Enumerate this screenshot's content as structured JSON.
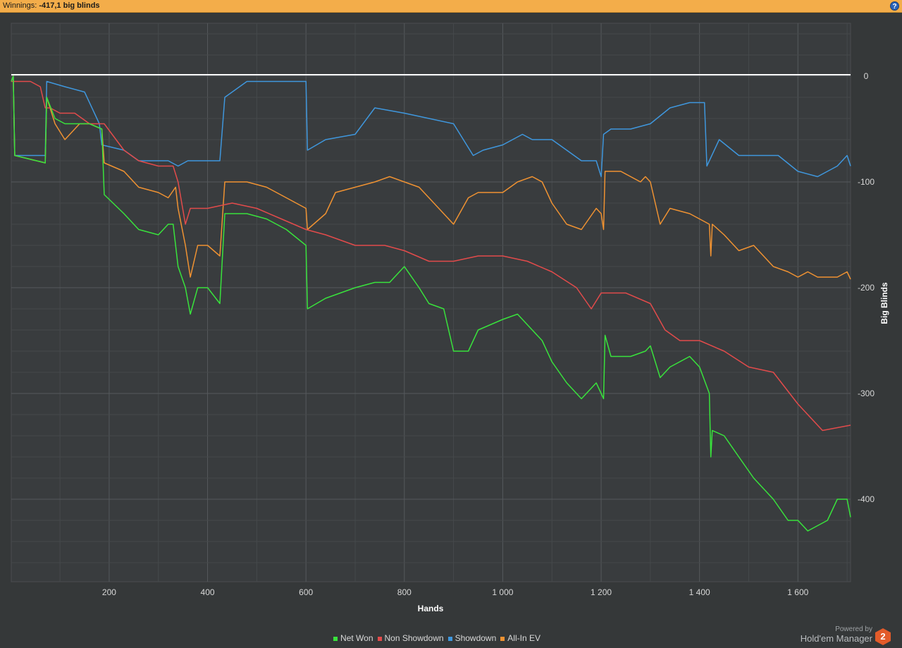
{
  "header": {
    "winnings_label": "Winnings:",
    "winnings_value": "-417,1 big blinds",
    "help_glyph": "?"
  },
  "branding": {
    "powered_by": "Powered by",
    "product": "Hold'em Manager",
    "logo_text": "2"
  },
  "chart_data": {
    "type": "line",
    "title": "",
    "xlabel": "Hands",
    "ylabel": "Big Blinds",
    "xlim": [
      1,
      1707
    ],
    "ylim": [
      -478,
      50
    ],
    "x_ticks": [
      200,
      400,
      600,
      800,
      1000,
      1200,
      1400,
      1600
    ],
    "x_tick_labels": [
      "200",
      "400",
      "600",
      "800",
      "1 000",
      "1 200",
      "1 400",
      "1 600"
    ],
    "y_ticks": [
      0,
      -100,
      -200,
      -300,
      -400
    ],
    "y_tick_labels": [
      "0",
      "-100",
      "-200",
      "-300",
      "-400"
    ],
    "grid": true,
    "legend_position": "bottom-center",
    "series": [
      {
        "name": "Net Won",
        "color": "#39e23c",
        "x": [
          1,
          5,
          8,
          70,
          73,
          90,
          110,
          140,
          160,
          185,
          190,
          230,
          260,
          300,
          320,
          330,
          340,
          355,
          365,
          380,
          400,
          425,
          435,
          480,
          520,
          560,
          600,
          603,
          640,
          700,
          740,
          770,
          800,
          830,
          850,
          880,
          900,
          930,
          950,
          1000,
          1030,
          1060,
          1080,
          1100,
          1130,
          1160,
          1190,
          1200,
          1205,
          1208,
          1220,
          1260,
          1290,
          1300,
          1320,
          1340,
          1380,
          1400,
          1420,
          1423,
          1426,
          1450,
          1480,
          1510,
          1550,
          1580,
          1600,
          1620,
          1640,
          1660,
          1680,
          1700,
          1707
        ],
        "y": [
          -5,
          0,
          -75,
          -82,
          -20,
          -40,
          -45,
          -45,
          -45,
          -50,
          -112,
          -130,
          -145,
          -150,
          -140,
          -140,
          -180,
          -200,
          -225,
          -200,
          -200,
          -215,
          -130,
          -130,
          -135,
          -145,
          -160,
          -220,
          -210,
          -200,
          -195,
          -195,
          -180,
          -200,
          -215,
          -220,
          -260,
          -260,
          -240,
          -230,
          -225,
          -240,
          -250,
          -270,
          -290,
          -305,
          -290,
          -300,
          -305,
          -245,
          -265,
          -265,
          -260,
          -255,
          -285,
          -275,
          -265,
          -275,
          -300,
          -360,
          -335,
          -340,
          -360,
          -380,
          -400,
          -420,
          -420,
          -430,
          -425,
          -420,
          -400,
          -400,
          -417
        ]
      },
      {
        "name": "Non Showdown",
        "color": "#e24b4b",
        "x": [
          1,
          20,
          40,
          60,
          70,
          80,
          100,
          130,
          160,
          190,
          230,
          260,
          300,
          330,
          340,
          355,
          365,
          380,
          400,
          450,
          500,
          550,
          600,
          640,
          700,
          760,
          800,
          850,
          900,
          950,
          1000,
          1050,
          1100,
          1150,
          1180,
          1200,
          1250,
          1300,
          1330,
          1360,
          1400,
          1450,
          1500,
          1550,
          1600,
          1650,
          1707
        ],
        "y": [
          -5,
          -5,
          -5,
          -10,
          -30,
          -30,
          -35,
          -35,
          -45,
          -45,
          -70,
          -80,
          -85,
          -85,
          -100,
          -140,
          -125,
          -125,
          -125,
          -120,
          -125,
          -135,
          -145,
          -150,
          -160,
          -160,
          -165,
          -175,
          -175,
          -170,
          -170,
          -175,
          -185,
          -200,
          -220,
          -205,
          -205,
          -215,
          -240,
          -250,
          -250,
          -260,
          -275,
          -280,
          -310,
          -335,
          -330
        ]
      },
      {
        "name": "Showdown",
        "color": "#3f97dd",
        "x": [
          1,
          5,
          8,
          70,
          73,
          110,
          150,
          180,
          185,
          230,
          260,
          300,
          320,
          340,
          360,
          380,
          400,
          425,
          435,
          480,
          500,
          560,
          600,
          603,
          640,
          700,
          740,
          800,
          850,
          900,
          940,
          960,
          1000,
          1040,
          1060,
          1080,
          1100,
          1130,
          1160,
          1190,
          1200,
          1205,
          1220,
          1260,
          1300,
          1340,
          1380,
          1400,
          1410,
          1415,
          1440,
          1480,
          1520,
          1560,
          1600,
          1640,
          1680,
          1700,
          1707
        ],
        "y": [
          -5,
          0,
          -75,
          -75,
          -5,
          -10,
          -15,
          -45,
          -65,
          -70,
          -80,
          -80,
          -80,
          -85,
          -80,
          -80,
          -80,
          -80,
          -20,
          -5,
          -5,
          -5,
          -5,
          -70,
          -60,
          -55,
          -30,
          -35,
          -40,
          -45,
          -75,
          -70,
          -65,
          -55,
          -60,
          -60,
          -60,
          -70,
          -80,
          -80,
          -95,
          -55,
          -50,
          -50,
          -45,
          -30,
          -25,
          -25,
          -25,
          -85,
          -60,
          -75,
          -75,
          -75,
          -90,
          -95,
          -85,
          -75,
          -85
        ]
      },
      {
        "name": "All-In EV",
        "color": "#ef9232",
        "x": [
          1,
          5,
          8,
          70,
          73,
          90,
          110,
          140,
          160,
          185,
          190,
          230,
          260,
          300,
          320,
          335,
          340,
          355,
          365,
          380,
          400,
          425,
          435,
          480,
          520,
          560,
          600,
          603,
          640,
          660,
          700,
          740,
          770,
          800,
          830,
          860,
          900,
          930,
          950,
          1000,
          1030,
          1060,
          1080,
          1100,
          1130,
          1160,
          1190,
          1200,
          1205,
          1208,
          1240,
          1280,
          1290,
          1300,
          1320,
          1340,
          1380,
          1400,
          1420,
          1423,
          1426,
          1450,
          1480,
          1510,
          1550,
          1580,
          1600,
          1620,
          1640,
          1660,
          1680,
          1700,
          1707
        ],
        "y": [
          -5,
          0,
          -75,
          -82,
          -20,
          -45,
          -60,
          -45,
          -45,
          -50,
          -82,
          -90,
          -105,
          -110,
          -115,
          -105,
          -125,
          -160,
          -190,
          -160,
          -160,
          -170,
          -100,
          -100,
          -105,
          -115,
          -125,
          -145,
          -130,
          -110,
          -105,
          -100,
          -95,
          -100,
          -105,
          -120,
          -140,
          -115,
          -110,
          -110,
          -100,
          -95,
          -100,
          -120,
          -140,
          -145,
          -125,
          -130,
          -145,
          -90,
          -90,
          -100,
          -95,
          -100,
          -140,
          -125,
          -130,
          -135,
          -140,
          -170,
          -140,
          -150,
          -165,
          -160,
          -180,
          -185,
          -190,
          -185,
          -190,
          -190,
          -190,
          -185,
          -192
        ]
      }
    ]
  }
}
